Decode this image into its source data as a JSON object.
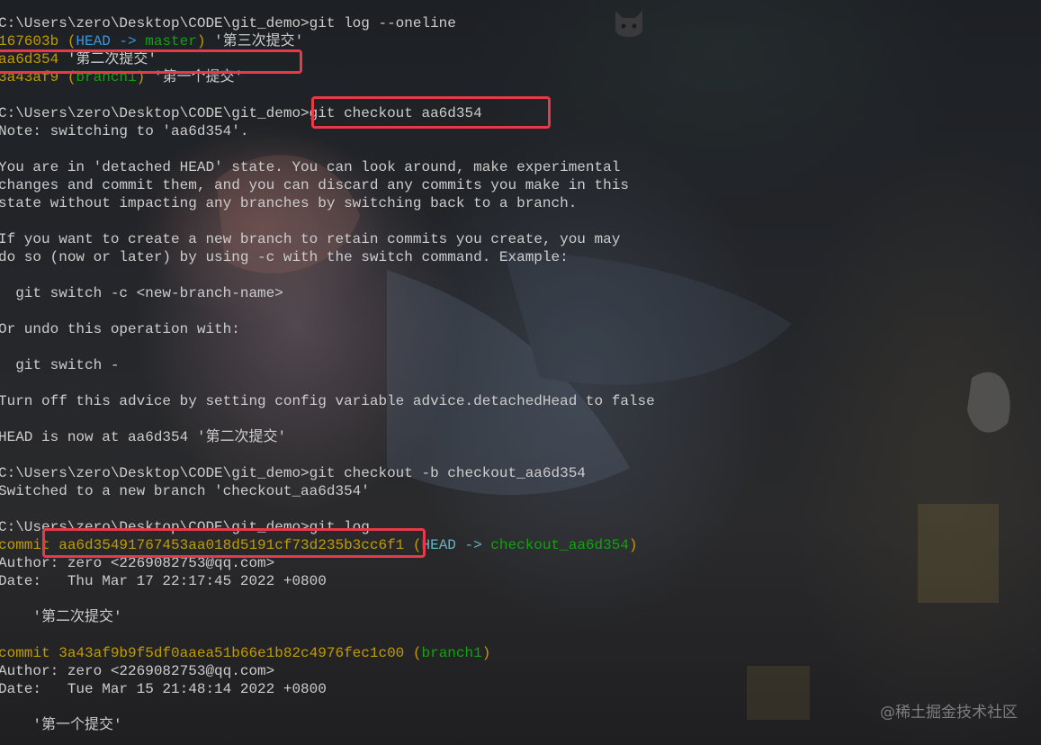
{
  "terminal": {
    "lines": [
      [
        {
          "t": "C:\\Users\\zero\\Desktop\\CODE\\git_demo>git log --oneline",
          "c": "default"
        }
      ],
      [
        {
          "t": "167603b ",
          "c": "yellow"
        },
        {
          "t": "(",
          "c": "yellow"
        },
        {
          "t": "HEAD -> ",
          "c": "cyan"
        },
        {
          "t": "master",
          "c": "green"
        },
        {
          "t": ")",
          "c": "yellow"
        },
        {
          "t": " '第三次提交'",
          "c": "default"
        }
      ],
      [
        {
          "t": "aa6d354",
          "c": "yellow"
        },
        {
          "t": " '第二次提交'",
          "c": "default"
        }
      ],
      [
        {
          "t": "3a43af9 ",
          "c": "yellow"
        },
        {
          "t": "(",
          "c": "yellow"
        },
        {
          "t": "branch1",
          "c": "green"
        },
        {
          "t": ")",
          "c": "yellow"
        },
        {
          "t": " '第一个提交'",
          "c": "default"
        }
      ],
      [
        {
          "t": "",
          "c": "default"
        }
      ],
      [
        {
          "t": "C:\\Users\\zero\\Desktop\\CODE\\git_demo>git checkout aa6d354",
          "c": "default"
        }
      ],
      [
        {
          "t": "Note: switching to 'aa6d354'.",
          "c": "default"
        }
      ],
      [
        {
          "t": "",
          "c": "default"
        }
      ],
      [
        {
          "t": "You are in 'detached HEAD' state. You can look around, make experimental",
          "c": "default"
        }
      ],
      [
        {
          "t": "changes and commit them, and you can discard any commits you make in this",
          "c": "default"
        }
      ],
      [
        {
          "t": "state without impacting any branches by switching back to a branch.",
          "c": "default"
        }
      ],
      [
        {
          "t": "",
          "c": "default"
        }
      ],
      [
        {
          "t": "If you want to create a new branch to retain commits you create, you may",
          "c": "default"
        }
      ],
      [
        {
          "t": "do so (now or later) by using -c with the switch command. Example:",
          "c": "default"
        }
      ],
      [
        {
          "t": "",
          "c": "default"
        }
      ],
      [
        {
          "t": "  git switch -c <new-branch-name>",
          "c": "default"
        }
      ],
      [
        {
          "t": "",
          "c": "default"
        }
      ],
      [
        {
          "t": "Or undo this operation with:",
          "c": "default"
        }
      ],
      [
        {
          "t": "",
          "c": "default"
        }
      ],
      [
        {
          "t": "  git switch -",
          "c": "default"
        }
      ],
      [
        {
          "t": "",
          "c": "default"
        }
      ],
      [
        {
          "t": "Turn off this advice by setting config variable advice.detachedHead to false",
          "c": "default"
        }
      ],
      [
        {
          "t": "",
          "c": "default"
        }
      ],
      [
        {
          "t": "HEAD is now at aa6d354 '第二次提交'",
          "c": "default"
        }
      ],
      [
        {
          "t": "",
          "c": "default"
        }
      ],
      [
        {
          "t": "C:\\Users\\zero\\Desktop\\CODE\\git_demo>git checkout -b checkout_aa6d354",
          "c": "default"
        }
      ],
      [
        {
          "t": "Switched to a new branch 'checkout_aa6d354'",
          "c": "default"
        }
      ],
      [
        {
          "t": "",
          "c": "default"
        }
      ],
      [
        {
          "t": "C:\\Users\\zero\\Desktop\\CODE\\git_demo>git log",
          "c": "default"
        }
      ],
      [
        {
          "t": "commit aa6d35491767453aa018d5191cf73d235b3cc6f1 ",
          "c": "yellow"
        },
        {
          "t": "(",
          "c": "yellow"
        },
        {
          "t": "HEAD -> ",
          "c": "cyan2"
        },
        {
          "t": "checkout_aa6d354",
          "c": "green"
        },
        {
          "t": ")",
          "c": "yellow"
        }
      ],
      [
        {
          "t": "Author: zero <2269082753@qq.com>",
          "c": "default"
        }
      ],
      [
        {
          "t": "Date:   Thu Mar 17 22:17:45 2022 +0800",
          "c": "default"
        }
      ],
      [
        {
          "t": "",
          "c": "default"
        }
      ],
      [
        {
          "t": "    '第二次提交'",
          "c": "default"
        }
      ],
      [
        {
          "t": "",
          "c": "default"
        }
      ],
      [
        {
          "t": "commit 3a43af9b9f5df0aaea51b66e1b82c4976fec1c00 ",
          "c": "yellow"
        },
        {
          "t": "(",
          "c": "yellow"
        },
        {
          "t": "branch1",
          "c": "green"
        },
        {
          "t": ")",
          "c": "yellow"
        }
      ],
      [
        {
          "t": "Author: zero <2269082753@qq.com>",
          "c": "default"
        }
      ],
      [
        {
          "t": "Date:   Tue Mar 15 21:48:14 2022 +0800",
          "c": "default"
        }
      ],
      [
        {
          "t": "",
          "c": "default"
        }
      ],
      [
        {
          "t": "    '第一个提交'",
          "c": "default"
        }
      ]
    ]
  },
  "watermark": {
    "text": "@稀土掘金技术社区"
  },
  "colors": {
    "highlight_box": "#e8394a",
    "default_text": "#cccccc",
    "yellow": "#c19c00",
    "cyan": "#3a96dd",
    "green": "#13a10e"
  },
  "icons": {
    "corner_logo": "cat-face-icon"
  }
}
